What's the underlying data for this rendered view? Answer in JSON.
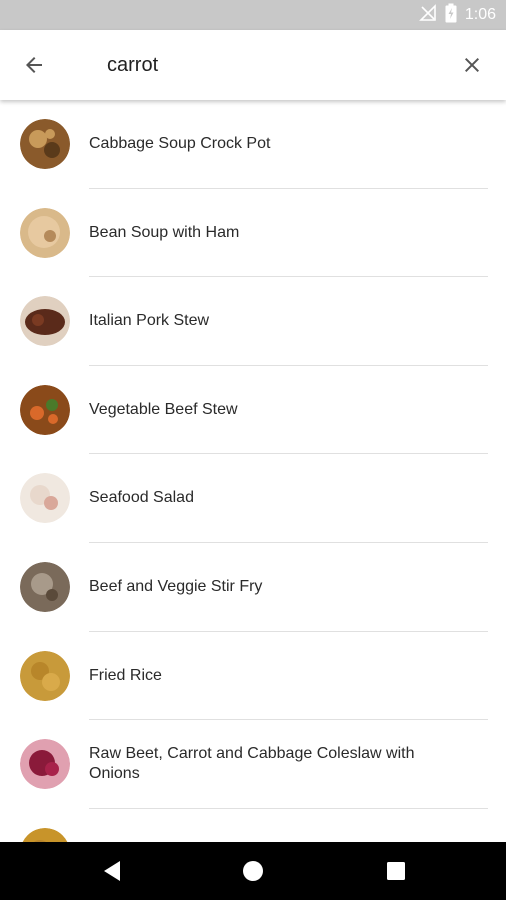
{
  "status_bar": {
    "time": "1:06"
  },
  "search": {
    "query": "carrot"
  },
  "results": [
    {
      "title": "Cabbage Soup Crock Pot",
      "thumb_colors": [
        "#8a5a2b",
        "#c89a5a",
        "#5a3a1a"
      ]
    },
    {
      "title": "Bean Soup with Ham",
      "thumb_colors": [
        "#d9b98a",
        "#e7c9a0",
        "#b58a5a"
      ]
    },
    {
      "title": "Italian Pork Stew",
      "thumb_colors": [
        "#5a2a1a",
        "#7a3a22",
        "#e0d0c0"
      ]
    },
    {
      "title": "Vegetable Beef Stew",
      "thumb_colors": [
        "#8a4a1a",
        "#d9692a",
        "#4a7a2a"
      ]
    },
    {
      "title": "Seafood Salad",
      "thumb_colors": [
        "#e8d8cc",
        "#d9a89a",
        "#f0e8e0"
      ]
    },
    {
      "title": "Beef and Veggie Stir Fry",
      "thumb_colors": [
        "#7a6a5a",
        "#a89a8a",
        "#5a4a3a"
      ]
    },
    {
      "title": "Fried Rice",
      "thumb_colors": [
        "#c89a3a",
        "#b8862a",
        "#d9aa4a"
      ]
    },
    {
      "title": "Raw Beet, Carrot and Cabbage Coleslaw with Onions",
      "thumb_colors": [
        "#8a1a3a",
        "#a8224a",
        "#e0a0b0"
      ]
    },
    {
      "title": "",
      "thumb_colors": [
        "#c8942a",
        "#b8842a",
        "#d9a43a"
      ]
    }
  ]
}
